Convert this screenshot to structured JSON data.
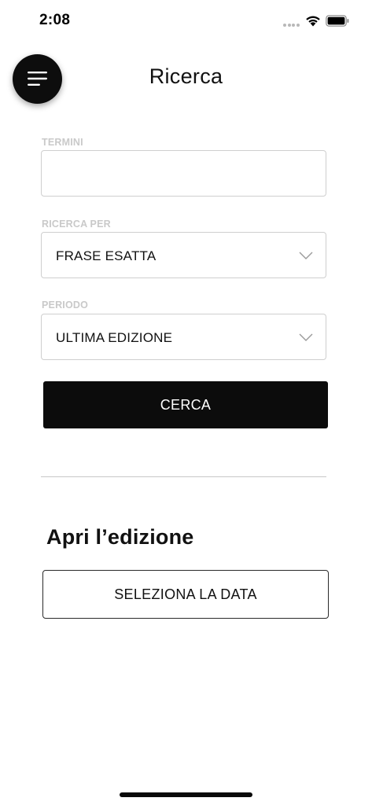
{
  "status_bar": {
    "time": "2:08",
    "icons": [
      "signal-dots-icon",
      "wifi-icon",
      "battery-icon"
    ]
  },
  "header": {
    "menu_icon": "hamburger-menu-icon",
    "title": "Ricerca"
  },
  "search_form": {
    "terms": {
      "label": "TERMINI",
      "value": "",
      "placeholder": ""
    },
    "search_by": {
      "label": "RICERCA PER",
      "selected": "FRASE ESATTA",
      "icon": "chevron-down-icon"
    },
    "period": {
      "label": "PERIODO",
      "selected": "ULTIMA EDIZIONE",
      "icon": "chevron-down-icon"
    },
    "submit_label": "CERCA"
  },
  "edition": {
    "title": "Apri l’edizione",
    "select_date_label": "SELEZIONA LA DATA"
  },
  "colors": {
    "primary": "#0c0c0c",
    "label_gray": "#c9c9c9",
    "border": "#cfcfcf",
    "background": "#ffffff"
  }
}
